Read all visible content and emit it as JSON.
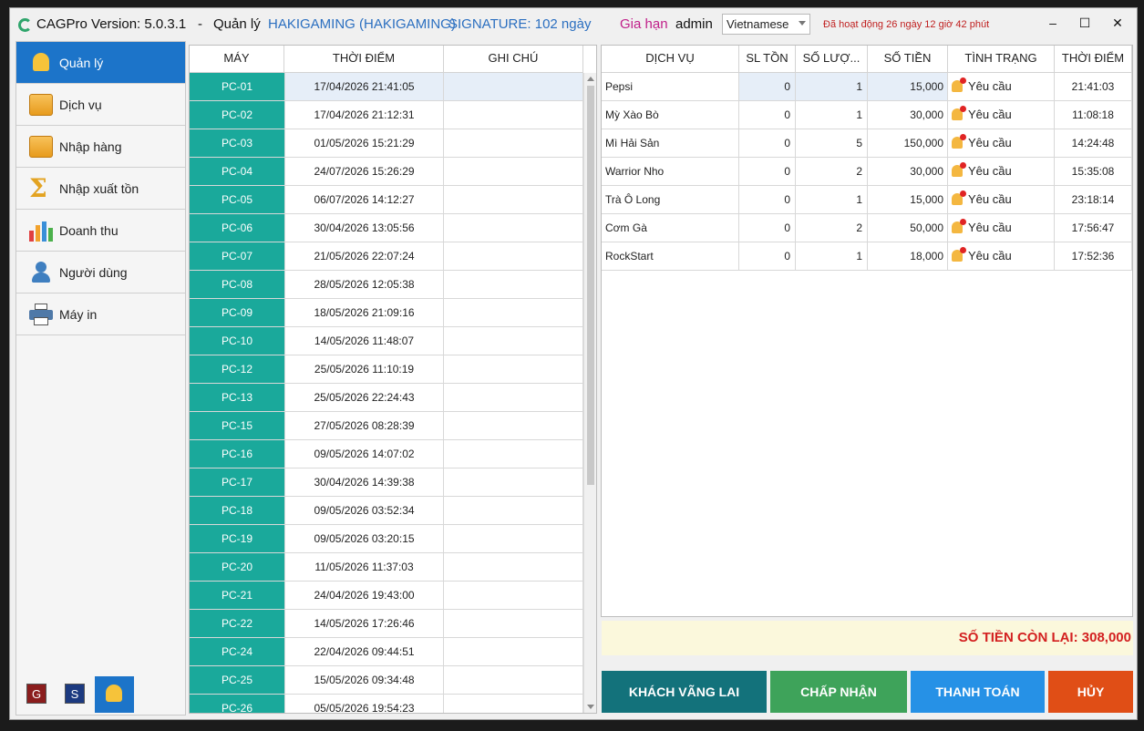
{
  "window": {
    "app_name": "CAGPro Version: 5.0.3.1",
    "separator": "-",
    "section": "Quản lý",
    "shop": "HAKIGAMING (HAKIGAMING)",
    "signature": "SIGNATURE: 102 ngày",
    "renew_link": "Gia hạn",
    "user": "admin",
    "language": "Vietnamese",
    "uptime": "Đã hoạt động 26 ngày 12 giờ 42 phút",
    "minimize": "–",
    "maximize": "☐",
    "close": "✕"
  },
  "sidebar": {
    "items": [
      {
        "label": "Quản lý",
        "icon": "bell-icon",
        "active": true
      },
      {
        "label": "Dịch vụ",
        "icon": "service-box-icon",
        "active": false
      },
      {
        "label": "Nhập hàng",
        "icon": "box-icon",
        "active": false
      },
      {
        "label": "Nhập xuất tồn",
        "icon": "sigma-icon",
        "active": false
      },
      {
        "label": "Doanh thu",
        "icon": "bar-chart-icon",
        "active": false
      },
      {
        "label": "Người dùng",
        "icon": "user-icon",
        "active": false
      },
      {
        "label": "Máy in",
        "icon": "printer-icon",
        "active": false
      }
    ],
    "mini_buttons": {
      "g": "G",
      "s": "S"
    }
  },
  "machines": {
    "headers": {
      "machine": "MÁY",
      "time": "THỜI ĐIỂM",
      "note": "GHI CHÚ"
    },
    "rows": [
      {
        "pc": "PC-01",
        "time": "17/04/2026 21:41:05",
        "note": ""
      },
      {
        "pc": "PC-02",
        "time": "17/04/2026 21:12:31",
        "note": ""
      },
      {
        "pc": "PC-03",
        "time": "01/05/2026 15:21:29",
        "note": ""
      },
      {
        "pc": "PC-04",
        "time": "24/07/2026 15:26:29",
        "note": ""
      },
      {
        "pc": "PC-05",
        "time": "06/07/2026 14:12:27",
        "note": ""
      },
      {
        "pc": "PC-06",
        "time": "30/04/2026 13:05:56",
        "note": ""
      },
      {
        "pc": "PC-07",
        "time": "21/05/2026 22:07:24",
        "note": ""
      },
      {
        "pc": "PC-08",
        "time": "28/05/2026 12:05:38",
        "note": ""
      },
      {
        "pc": "PC-09",
        "time": "18/05/2026 21:09:16",
        "note": ""
      },
      {
        "pc": "PC-10",
        "time": "14/05/2026 11:48:07",
        "note": ""
      },
      {
        "pc": "PC-12",
        "time": "25/05/2026 11:10:19",
        "note": ""
      },
      {
        "pc": "PC-13",
        "time": "25/05/2026 22:24:43",
        "note": ""
      },
      {
        "pc": "PC-15",
        "time": "27/05/2026 08:28:39",
        "note": ""
      },
      {
        "pc": "PC-16",
        "time": "09/05/2026 14:07:02",
        "note": ""
      },
      {
        "pc": "PC-17",
        "time": "30/04/2026 14:39:38",
        "note": ""
      },
      {
        "pc": "PC-18",
        "time": "09/05/2026 03:52:34",
        "note": ""
      },
      {
        "pc": "PC-19",
        "time": "09/05/2026 03:20:15",
        "note": ""
      },
      {
        "pc": "PC-20",
        "time": "11/05/2026 11:37:03",
        "note": ""
      },
      {
        "pc": "PC-21",
        "time": "24/04/2026 19:43:00",
        "note": ""
      },
      {
        "pc": "PC-22",
        "time": "14/05/2026 17:26:46",
        "note": ""
      },
      {
        "pc": "PC-24",
        "time": "22/04/2026 09:44:51",
        "note": ""
      },
      {
        "pc": "PC-25",
        "time": "15/05/2026 09:34:48",
        "note": ""
      },
      {
        "pc": "PC-26",
        "time": "05/05/2026 19:54:23",
        "note": ""
      }
    ]
  },
  "orders": {
    "headers": {
      "service": "DỊCH VỤ",
      "stock": "SL TỒN",
      "qty": "SỐ LƯỢ...",
      "amount": "SỐ TIỀN",
      "status": "TÌNH TRẠNG",
      "time": "THỜI ĐIỂM"
    },
    "rows": [
      {
        "service": "Pepsi",
        "stock": "0",
        "qty": "1",
        "amount": "15,000",
        "status": "Yêu cầu",
        "time": "21:41:03"
      },
      {
        "service": "Mỳ Xào Bò",
        "stock": "0",
        "qty": "1",
        "amount": "30,000",
        "status": "Yêu cầu",
        "time": "11:08:18"
      },
      {
        "service": "Mì Hải Sản",
        "stock": "0",
        "qty": "5",
        "amount": "150,000",
        "status": "Yêu cầu",
        "time": "14:24:48"
      },
      {
        "service": "Warrior Nho",
        "stock": "0",
        "qty": "2",
        "amount": "30,000",
        "status": "Yêu cầu",
        "time": "15:35:08"
      },
      {
        "service": "Trà Ô Long",
        "stock": "0",
        "qty": "1",
        "amount": "15,000",
        "status": "Yêu cầu",
        "time": "23:18:14"
      },
      {
        "service": "Cơm Gà",
        "stock": "0",
        "qty": "2",
        "amount": "50,000",
        "status": "Yêu cầu",
        "time": "17:56:47"
      },
      {
        "service": "RockStart",
        "stock": "0",
        "qty": "1",
        "amount": "18,000",
        "status": "Yêu cầu",
        "time": "17:52:36"
      }
    ],
    "remaining": "SỐ TIỀN CÒN LẠI: 308,000"
  },
  "actions": {
    "walk_in": "KHÁCH VÃNG LAI",
    "accept": "CHẤP NHẬN",
    "pay": "THANH TOÁN",
    "cancel": "HỦY"
  },
  "colors": {
    "accent": "#1c74c9",
    "machine_cell": "#1aa99b",
    "remaining_text": "#d32020",
    "walk_in": "#13727b",
    "accept": "#3ea35a",
    "pay": "#2691e6",
    "cancel": "#e04e16"
  }
}
